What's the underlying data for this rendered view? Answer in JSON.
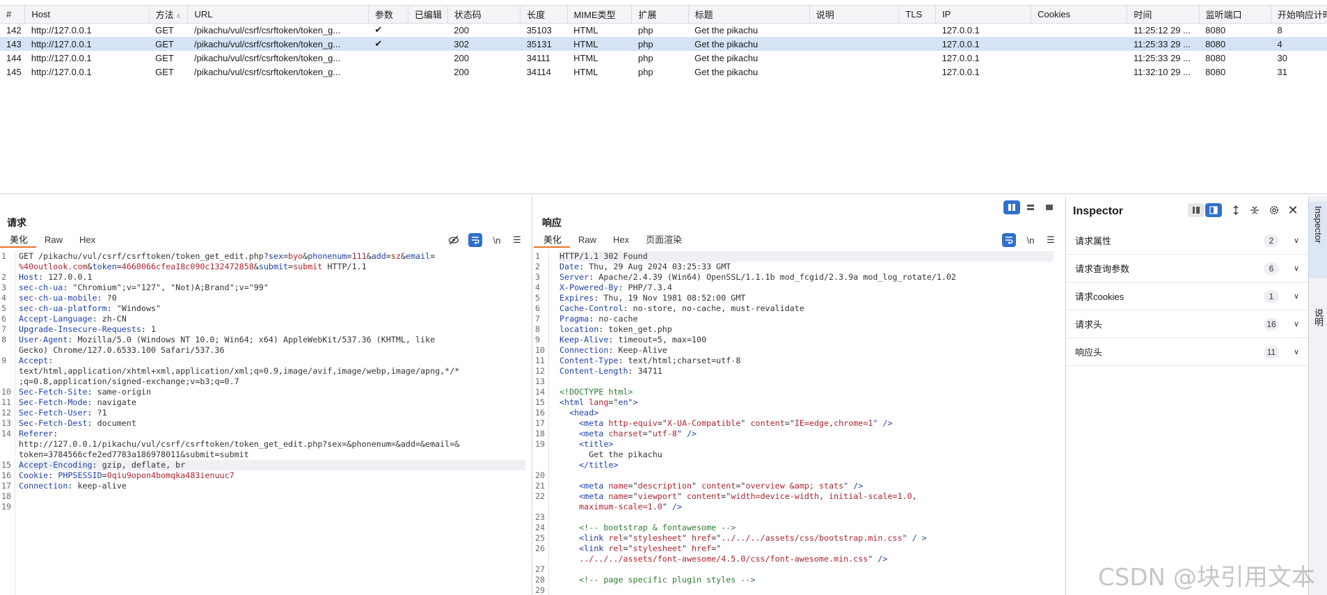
{
  "history": {
    "columns": [
      "#",
      "Host",
      "方法",
      "URL",
      "参数",
      "已编辑",
      "状态码",
      "长度",
      "MIME类型",
      "扩展",
      "标题",
      "说明",
      "TLS",
      "IP",
      "Cookies",
      "时间",
      "监听端口",
      "开始响应计时"
    ],
    "rows": [
      {
        "num": "142",
        "host": "http://127.0.0.1",
        "method": "GET",
        "url": "/pikachu/vul/csrf/csrftoken/token_g...",
        "params": "✔",
        "edited": "",
        "status": "200",
        "length": "35103",
        "mime": "HTML",
        "ext": "php",
        "title": "Get the pikachu",
        "comment": "",
        "tls": "",
        "ip": "127.0.0.1",
        "cookies": "",
        "time": "11:25:12 29 ...",
        "port": "8080",
        "start": "8"
      },
      {
        "num": "143",
        "host": "http://127.0.0.1",
        "method": "GET",
        "url": "/pikachu/vul/csrf/csrftoken/token_g...",
        "params": "✔",
        "edited": "",
        "status": "302",
        "length": "35131",
        "mime": "HTML",
        "ext": "php",
        "title": "Get the pikachu",
        "comment": "",
        "tls": "",
        "ip": "127.0.0.1",
        "cookies": "",
        "time": "11:25:33 29 ...",
        "port": "8080",
        "start": "4",
        "selected": true
      },
      {
        "num": "144",
        "host": "http://127.0.0.1",
        "method": "GET",
        "url": "/pikachu/vul/csrf/csrftoken/token_g...",
        "params": "",
        "edited": "",
        "status": "200",
        "length": "34111",
        "mime": "HTML",
        "ext": "php",
        "title": "Get the pikachu",
        "comment": "",
        "tls": "",
        "ip": "127.0.0.1",
        "cookies": "",
        "time": "11:25:33 29 ...",
        "port": "8080",
        "start": "30"
      },
      {
        "num": "145",
        "host": "http://127.0.0.1",
        "method": "GET",
        "url": "/pikachu/vul/csrf/csrftoken/token_g...",
        "params": "",
        "edited": "",
        "status": "200",
        "length": "34114",
        "mime": "HTML",
        "ext": "php",
        "title": "Get the pikachu",
        "comment": "",
        "tls": "",
        "ip": "127.0.0.1",
        "cookies": "",
        "time": "11:32:10 29 ...",
        "port": "8080",
        "start": "31"
      }
    ]
  },
  "request": {
    "title": "请求",
    "tabs": [
      "美化",
      "Raw",
      "Hex"
    ],
    "active_tab": "美化",
    "line_numbers": [
      "1",
      "",
      "2",
      "3",
      "4",
      "5",
      "6",
      "7",
      "8",
      "",
      "9",
      "",
      "",
      "10",
      "11",
      "12",
      "13",
      "14",
      "",
      "",
      "15",
      "16",
      "17",
      "18",
      "19"
    ],
    "lines": [
      [
        [
          "GET /pikachu/vul/csrf/csrftoken/token_get_edit.php?",
          "v"
        ],
        [
          "sex",
          "k"
        ],
        [
          "=",
          "v"
        ],
        [
          "byo",
          "r"
        ],
        [
          "&",
          "v"
        ],
        [
          "phonenum",
          "k"
        ],
        [
          "=",
          "v"
        ],
        [
          "111",
          "r"
        ],
        [
          "&",
          "v"
        ],
        [
          "add",
          "k"
        ],
        [
          "=",
          "v"
        ],
        [
          "sz",
          "r"
        ],
        [
          "&",
          "v"
        ],
        [
          "email",
          "k"
        ],
        [
          "=",
          "v"
        ]
      ],
      [
        [
          "%40outlook.com",
          "r"
        ],
        [
          "&",
          "v"
        ],
        [
          "token",
          "k"
        ],
        [
          "=",
          "v"
        ],
        [
          "4660066cfea18c090c132472858",
          "r"
        ],
        [
          "&",
          "v"
        ],
        [
          "submit",
          "k"
        ],
        [
          "=",
          "v"
        ],
        [
          "submit",
          "r"
        ],
        [
          " HTTP/1.1",
          "v"
        ]
      ],
      [
        [
          "Host",
          "k"
        ],
        [
          ": 127.0.0.1",
          "v"
        ]
      ],
      [
        [
          "sec-ch-ua",
          "k"
        ],
        [
          ": \"Chromium\";v=\"127\", \"Not)A;Brand\";v=\"99\"",
          "v"
        ]
      ],
      [
        [
          "sec-ch-ua-mobile",
          "k"
        ],
        [
          ": ?0",
          "v"
        ]
      ],
      [
        [
          "sec-ch-ua-platform",
          "k"
        ],
        [
          ": \"Windows\"",
          "v"
        ]
      ],
      [
        [
          "Accept-Language",
          "k"
        ],
        [
          ": zh-CN",
          "v"
        ]
      ],
      [
        [
          "Upgrade-Insecure-Requests",
          "k"
        ],
        [
          ": 1",
          "v"
        ]
      ],
      [
        [
          "User-Agent",
          "k"
        ],
        [
          ": Mozilla/5.0 (Windows NT 10.0; Win64; x64) AppleWebKit/537.36 (KHTML, like",
          "v"
        ]
      ],
      [
        [
          "Gecko) Chrome/127.0.6533.100 Safari/537.36",
          "v"
        ]
      ],
      [
        [
          "Accept",
          "k"
        ],
        [
          ":",
          "v"
        ]
      ],
      [
        [
          "text/html,application/xhtml+xml,application/xml;q=0.9,image/avif,image/webp,image/apng,*/*",
          "v"
        ]
      ],
      [
        [
          ";q=0.8,application/signed-exchange;v=b3;q=0.7",
          "v"
        ]
      ],
      [
        [
          "Sec-Fetch-Site",
          "k"
        ],
        [
          ": same-origin",
          "v"
        ]
      ],
      [
        [
          "Sec-Fetch-Mode",
          "k"
        ],
        [
          ": navigate",
          "v"
        ]
      ],
      [
        [
          "Sec-Fetch-User",
          "k"
        ],
        [
          ": ?1",
          "v"
        ]
      ],
      [
        [
          "Sec-Fetch-Dest",
          "k"
        ],
        [
          ": document",
          "v"
        ]
      ],
      [
        [
          "Referer",
          "k"
        ],
        [
          ":",
          "v"
        ]
      ],
      [
        [
          "http://127.0.0.1/pikachu/vul/csrf/csrftoken/token_get_edit.php?sex=&phonenum=&add=&email=&",
          "v"
        ]
      ],
      [
        [
          "token=3784566cfe2ed7783a186978011&submit=submit",
          "v"
        ]
      ],
      [
        [
          "Accept-Encoding",
          "k"
        ],
        [
          ": gzip, deflate, br",
          "v"
        ]
      ],
      [
        [
          "Cookie",
          "k"
        ],
        [
          ": ",
          "v"
        ],
        [
          "PHPSESSID",
          "k"
        ],
        [
          "=",
          "v"
        ],
        [
          "0qiu9opon4bomqka483ienuuc7",
          "r"
        ]
      ],
      [
        [
          "Connection",
          "k"
        ],
        [
          ": keep-alive",
          "v"
        ]
      ],
      [
        [
          "",
          "v"
        ]
      ],
      [
        [
          "",
          "v"
        ]
      ]
    ]
  },
  "response": {
    "title": "响应",
    "tabs": [
      "美化",
      "Raw",
      "Hex",
      "页面渲染"
    ],
    "active_tab": "美化",
    "line_numbers": [
      "1",
      "2",
      "3",
      "4",
      "5",
      "6",
      "7",
      "8",
      "9",
      "10",
      "11",
      "12",
      "13",
      "14",
      "15",
      "16",
      "17",
      "18",
      "19",
      "",
      "",
      "20",
      "21",
      "22",
      "",
      "23",
      "24",
      "25",
      "26",
      "",
      "27",
      "28",
      "29"
    ],
    "lines": [
      [
        [
          "HTTP/1.1 302 Found",
          "v"
        ]
      ],
      [
        [
          "Date",
          "k"
        ],
        [
          ": Thu, 29 Aug 2024 03:25:33 GMT",
          "v"
        ]
      ],
      [
        [
          "Server",
          "k"
        ],
        [
          ": Apache/2.4.39 (Win64) OpenSSL/1.1.1b mod_fcgid/2.3.9a mod_log_rotate/1.02",
          "v"
        ]
      ],
      [
        [
          "X-Powered-By",
          "k"
        ],
        [
          ": PHP/7.3.4",
          "v"
        ]
      ],
      [
        [
          "Expires",
          "k"
        ],
        [
          ": Thu, 19 Nov 1981 08:52:00 GMT",
          "v"
        ]
      ],
      [
        [
          "Cache-Control",
          "k"
        ],
        [
          ": no-store, no-cache, must-revalidate",
          "v"
        ]
      ],
      [
        [
          "Pragma",
          "k"
        ],
        [
          ": no-cache",
          "v"
        ]
      ],
      [
        [
          "location",
          "k"
        ],
        [
          ": token_get.php",
          "v"
        ]
      ],
      [
        [
          "Keep-Alive",
          "k"
        ],
        [
          ": timeout=5, max=100",
          "v"
        ]
      ],
      [
        [
          "Connection",
          "k"
        ],
        [
          ": Keep-Alive",
          "v"
        ]
      ],
      [
        [
          "Content-Type",
          "k"
        ],
        [
          ": text/html;charset=utf-8",
          "v"
        ]
      ],
      [
        [
          "Content-Length",
          "k"
        ],
        [
          ": 34711",
          "v"
        ]
      ],
      [
        [
          "",
          "v"
        ]
      ],
      [
        [
          "<!DOCTYPE html>",
          "cm"
        ]
      ],
      [
        [
          "<html ",
          "tag"
        ],
        [
          "lang",
          "attr"
        ],
        [
          "=\"",
          "v"
        ],
        [
          "en",
          "str"
        ],
        [
          "\">",
          "tag"
        ]
      ],
      [
        [
          "  <head>",
          "tag"
        ]
      ],
      [
        [
          "    <meta ",
          "tag"
        ],
        [
          "http-equiv",
          "attr"
        ],
        [
          "=\"",
          "v"
        ],
        [
          "X-UA-Compatible",
          "attr"
        ],
        [
          "\" ",
          "v"
        ],
        [
          "content",
          "attr"
        ],
        [
          "=\"",
          "v"
        ],
        [
          "IE=edge,chrome=1",
          "attr"
        ],
        [
          "\" />",
          "tag"
        ]
      ],
      [
        [
          "    <meta ",
          "tag"
        ],
        [
          "charset",
          "attr"
        ],
        [
          "=\"",
          "v"
        ],
        [
          "utf-8",
          "attr"
        ],
        [
          "\" />",
          "tag"
        ]
      ],
      [
        [
          "    <title>",
          "tag"
        ]
      ],
      [
        [
          "      Get the pikachu",
          "v"
        ]
      ],
      [
        [
          "    </title>",
          "tag"
        ]
      ],
      [
        [
          "",
          "v"
        ]
      ],
      [
        [
          "    <meta ",
          "tag"
        ],
        [
          "name",
          "attr"
        ],
        [
          "=\"",
          "v"
        ],
        [
          "description",
          "attr"
        ],
        [
          "\" ",
          "v"
        ],
        [
          "content",
          "attr"
        ],
        [
          "=\"",
          "v"
        ],
        [
          "overview &amp; stats",
          "attr"
        ],
        [
          "\" />",
          "tag"
        ]
      ],
      [
        [
          "    <meta ",
          "tag"
        ],
        [
          "name",
          "attr"
        ],
        [
          "=\"",
          "v"
        ],
        [
          "viewport",
          "attr"
        ],
        [
          "\" ",
          "v"
        ],
        [
          "content",
          "attr"
        ],
        [
          "=\"",
          "v"
        ],
        [
          "width=device-width, initial-scale=1.0,",
          "attr"
        ]
      ],
      [
        [
          "    maximum-scale=1.0",
          "attr"
        ],
        [
          "\" />",
          "tag"
        ]
      ],
      [
        [
          "",
          "v"
        ]
      ],
      [
        [
          "    <!-- bootstrap & fontawesome -->",
          "cm"
        ]
      ],
      [
        [
          "    <link ",
          "tag"
        ],
        [
          "rel",
          "attr"
        ],
        [
          "=\"",
          "v"
        ],
        [
          "stylesheet",
          "attr"
        ],
        [
          "\" ",
          "v"
        ],
        [
          "href",
          "attr"
        ],
        [
          "=\"",
          "v"
        ],
        [
          "../../../assets/css/bootstrap.min.css",
          "attr"
        ],
        [
          "\" / >",
          "tag"
        ]
      ],
      [
        [
          "    <link ",
          "tag"
        ],
        [
          "rel",
          "attr"
        ],
        [
          "=\"",
          "v"
        ],
        [
          "stylesheet",
          "attr"
        ],
        [
          "\" ",
          "v"
        ],
        [
          "href",
          "attr"
        ],
        [
          "=\"",
          "v"
        ]
      ],
      [
        [
          "    ../../../assets/font-awesome/4.5.0/css/font-awesome.min.css",
          "attr"
        ],
        [
          "\" />",
          "tag"
        ]
      ],
      [
        [
          "",
          "v"
        ]
      ],
      [
        [
          "    <!-- page specific plugin styles -->",
          "cm"
        ]
      ],
      [
        [
          "",
          "v"
        ]
      ]
    ]
  },
  "inspector": {
    "title": "Inspector",
    "sections": [
      {
        "label": "请求属性",
        "count": "2"
      },
      {
        "label": "请求查询参数",
        "count": "6"
      },
      {
        "label": "请求cookies",
        "count": "1"
      },
      {
        "label": "请求头",
        "count": "16"
      },
      {
        "label": "响应头",
        "count": "11"
      }
    ]
  },
  "side_rail": {
    "tabs": [
      "Inspector",
      "说明"
    ]
  },
  "watermark": "CSDN @块引用文本",
  "colors": {
    "accent_tab": "#e8702a",
    "selected_row": "#d5e3f5",
    "active_tool": "#2f6fce",
    "key": "#1f3fae",
    "value_red": "#b0232f"
  }
}
